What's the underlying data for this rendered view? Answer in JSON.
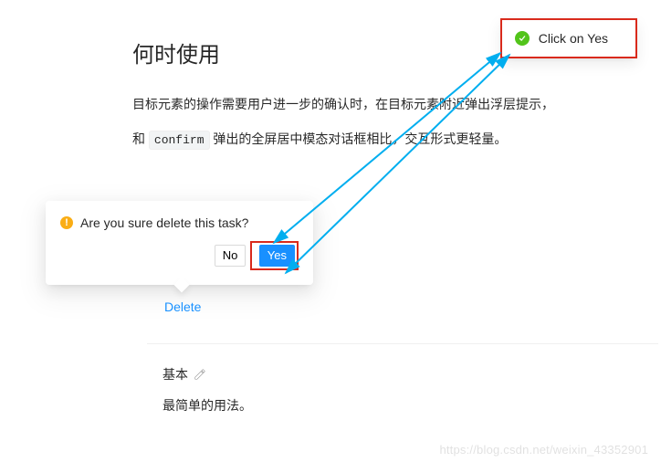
{
  "heading": "何时使用",
  "para1_a": "目标元素的操作需要用户进一步的确认时，在目标元素附近弹出浮层提示，",
  "para2_a": "和 ",
  "para2_code": "confirm",
  "para2_b": " 弹出的全屏居中模态对话框相比，交互形式更轻量。",
  "popconfirm": {
    "message": "Are you sure delete this task?",
    "no_label": "No",
    "yes_label": "Yes"
  },
  "delete_link_label": "Delete",
  "example": {
    "title": "基本",
    "desc": "最简单的用法。"
  },
  "notification": {
    "message": "Click on Yes"
  },
  "watermark": "https://blog.csdn.net/weixin_43352901"
}
